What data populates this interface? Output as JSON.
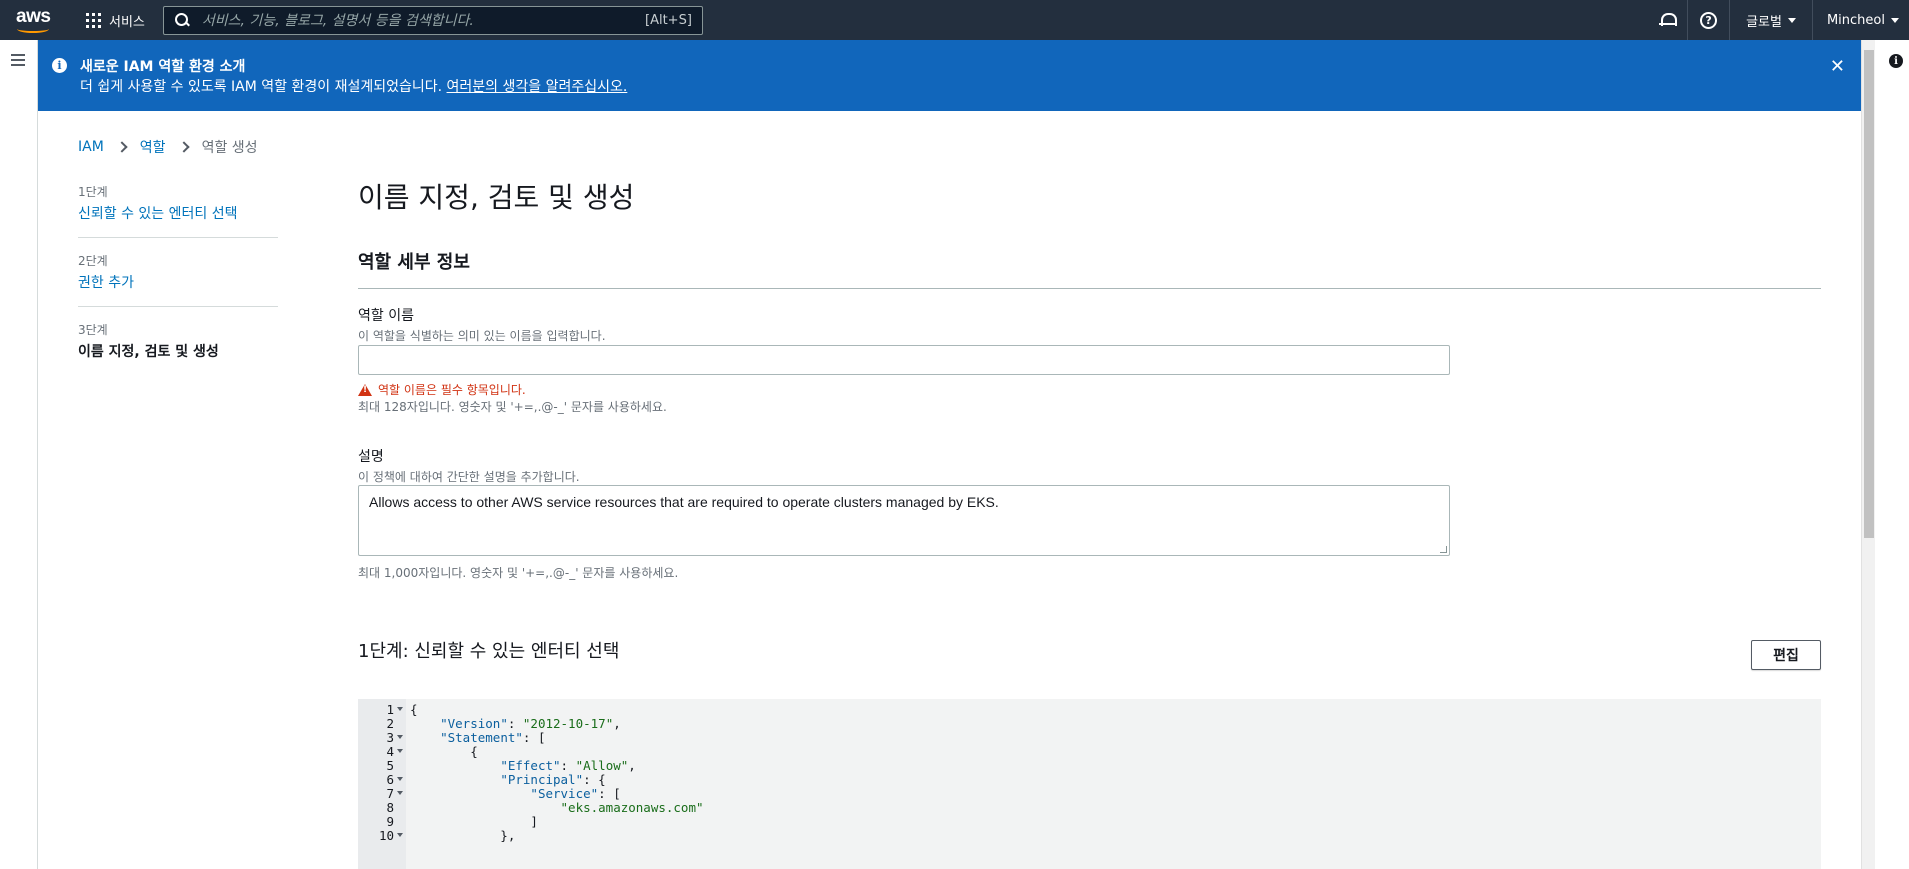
{
  "topnav": {
    "logo_text": "aws",
    "services_label": "서비스",
    "search_placeholder": "서비스, 기능, 블로그, 설명서 등을 검색합니다.",
    "search_shortcut": "[Alt+S]",
    "region_label": "글로벌",
    "user_label": "Mincheol",
    "icons": [
      "grid-icon",
      "search-icon",
      "bell-icon",
      "help-icon"
    ]
  },
  "flash": {
    "title": "새로운 IAM 역할 환경 소개",
    "message": "더 쉽게 사용할 수 있도록 IAM 역할 환경이 재설계되었습니다. ",
    "link": "여러분의 생각을 알려주십시오.",
    "color": "#1166bb"
  },
  "breadcrumb": {
    "items": [
      "IAM",
      "역할"
    ],
    "current": "역할 생성"
  },
  "steps": [
    {
      "num": "1단계",
      "label": "신뢰할 수 있는 엔터티 선택"
    },
    {
      "num": "2단계",
      "label": "권한 추가"
    },
    {
      "num": "3단계",
      "label": "이름 지정, 검토 및 생성"
    }
  ],
  "main": {
    "title": "이름 지정, 검토 및 생성",
    "section_title": "역할 세부 정보",
    "role_name": {
      "label": "역할 이름",
      "description": "이 역할을 식별하는 의미 있는 이름을 입력합니다.",
      "value": "",
      "error": "역할 이름은 필수 항목입니다.",
      "hint": "최대 128자입니다. 영숫자 및 '+=,.@-_' 문자를 사용하세요."
    },
    "description": {
      "label": "설명",
      "description": "이 정책에 대하여 간단한 설명을 추가합니다.",
      "value": "Allows access to other AWS service resources that are required to operate clusters managed by EKS.",
      "hint": "최대 1,000자입니다. 영숫자 및 '+=,.@-_' 문자를 사용하세요."
    },
    "step1_title": "1단계: 신뢰할 수 있는 엔터티 선택",
    "edit_button": "편집"
  },
  "code": {
    "lines": [
      {
        "n": "1",
        "fold": true,
        "text": "{"
      },
      {
        "n": "2",
        "fold": false,
        "text": "    \"Version\": \"2012-10-17\","
      },
      {
        "n": "3",
        "fold": true,
        "text": "    \"Statement\": ["
      },
      {
        "n": "4",
        "fold": true,
        "text": "        {"
      },
      {
        "n": "5",
        "fold": false,
        "text": "            \"Effect\": \"Allow\","
      },
      {
        "n": "6",
        "fold": true,
        "text": "            \"Principal\": {"
      },
      {
        "n": "7",
        "fold": true,
        "text": "                \"Service\": ["
      },
      {
        "n": "8",
        "fold": false,
        "text": "                    \"eks.amazonaws.com\""
      },
      {
        "n": "9",
        "fold": false,
        "text": "                ]"
      },
      {
        "n": "10",
        "fold": true,
        "text": "            },"
      }
    ]
  }
}
